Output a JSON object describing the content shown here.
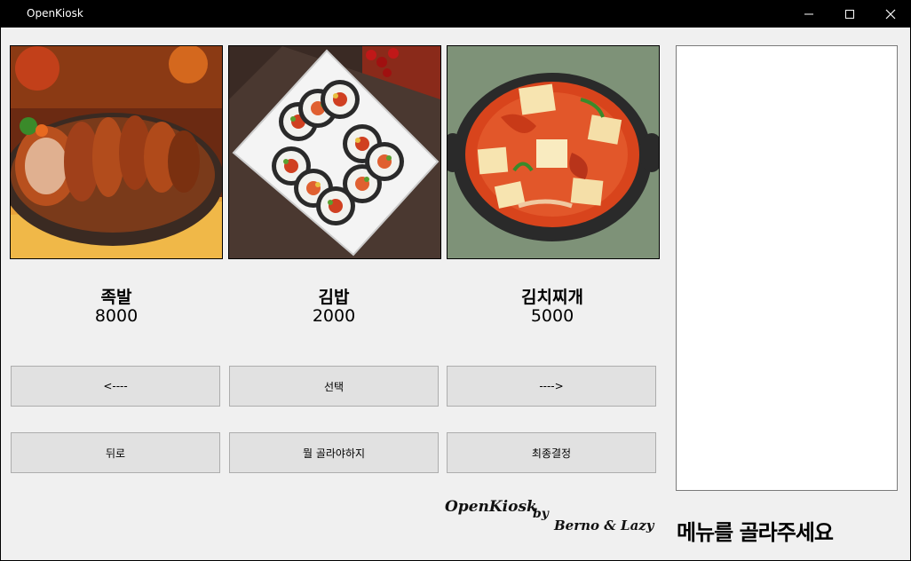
{
  "window": {
    "title": "OpenKiosk"
  },
  "menu": {
    "items": [
      {
        "name": "족발",
        "price": "8000",
        "image": "jokbal-image"
      },
      {
        "name": "김밥",
        "price": "2000",
        "image": "gimbap-image"
      },
      {
        "name": "김치찌개",
        "price": "5000",
        "image": "kimchi-jjigae-image"
      }
    ]
  },
  "buttons": {
    "prev": "<----",
    "select": "선택",
    "next": "---->",
    "back": "뒤로",
    "what_to_pick": "뭘 골라야하지",
    "final": "최종결정"
  },
  "credits": {
    "app": "OpenKiosk",
    "by": "by",
    "authors": "Berno & Lazy"
  },
  "status": {
    "prompt": "메뉴를 골라주세요"
  },
  "colors": {
    "titlebar": "#000000",
    "background": "#f0f0f0",
    "button": "#e1e1e1"
  }
}
